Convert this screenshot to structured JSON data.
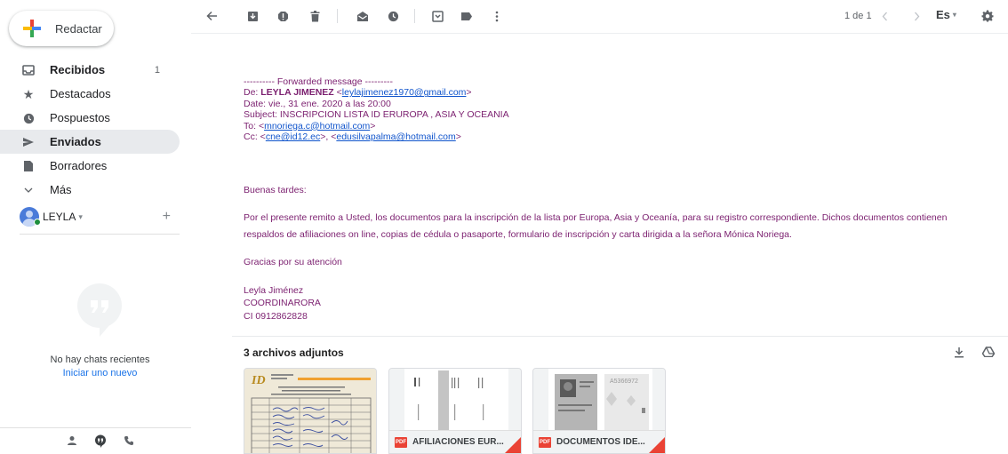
{
  "compose": {
    "label": "Redactar",
    "colors": [
      "#4285f4",
      "#ea4335",
      "#fbbc04",
      "#34a853"
    ]
  },
  "nav": [
    {
      "label": "Recibidos",
      "icon": "inbox-icon",
      "count": "1",
      "bold": true
    },
    {
      "label": "Destacados",
      "icon": "star-icon",
      "count": "",
      "bold": false
    },
    {
      "label": "Pospuestos",
      "icon": "clock-icon",
      "count": "",
      "bold": false
    },
    {
      "label": "Enviados",
      "icon": "send-icon",
      "count": "",
      "bold": true,
      "active": true
    },
    {
      "label": "Borradores",
      "icon": "draft-icon",
      "count": "",
      "bold": false
    },
    {
      "label": "Más",
      "icon": "chevron-down-icon",
      "count": "",
      "bold": false
    }
  ],
  "account": {
    "name": "LEYLA"
  },
  "chat": {
    "empty_text": "No hay chats recientes",
    "start_link": "Iniciar uno nuevo"
  },
  "toolbar": {
    "pagination": "1 de 1",
    "language": "Es"
  },
  "email": {
    "forward_header": "---------- Forwarded message ---------",
    "from_label": "De: ",
    "from_name": "LEYLA JIMENEZ",
    "from_email": "leylajimenez1970@gmail.com",
    "date_line": "Date: vie., 31 ene. 2020 a las 20:00",
    "subject_line": "Subject: INSCRIPCION LISTA ID ERUROPA , ASIA Y OCEANIA",
    "to_label": "To: ",
    "to_email": "mnoriega.c@hotmail.com",
    "cc_label": "Cc: ",
    "cc_email1": "cne@id12.ec",
    "cc_email2": "edusilvapalma@hotmail.com",
    "greeting": "Buenas tardes:",
    "body_line1": "Por el presente remito a Usted, los documentos para la inscripción de la lista por Europa, Asia y Oceanía, para su registro correspondiente. Dichos documentos contienen",
    "body_line2": "respaldos de afiliaciones on line, copias de cédula o pasaporte, formulario de inscripción y carta dirigida a la señora Mónica Noriega.",
    "thanks": "Gracias por su atención",
    "sig_name": "Leyla Jiménez",
    "sig_title": "COORDINARORA",
    "sig_ci": "CI 0912862828"
  },
  "attachments": {
    "title": "3 archivos adjuntos",
    "items": [
      {
        "name": "",
        "type": "image"
      },
      {
        "name": "AFILIACIONES EUR...",
        "type": "pdf"
      },
      {
        "name": "DOCUMENTOS IDE...",
        "type": "pdf"
      }
    ],
    "pdf_badge": "PDF"
  }
}
